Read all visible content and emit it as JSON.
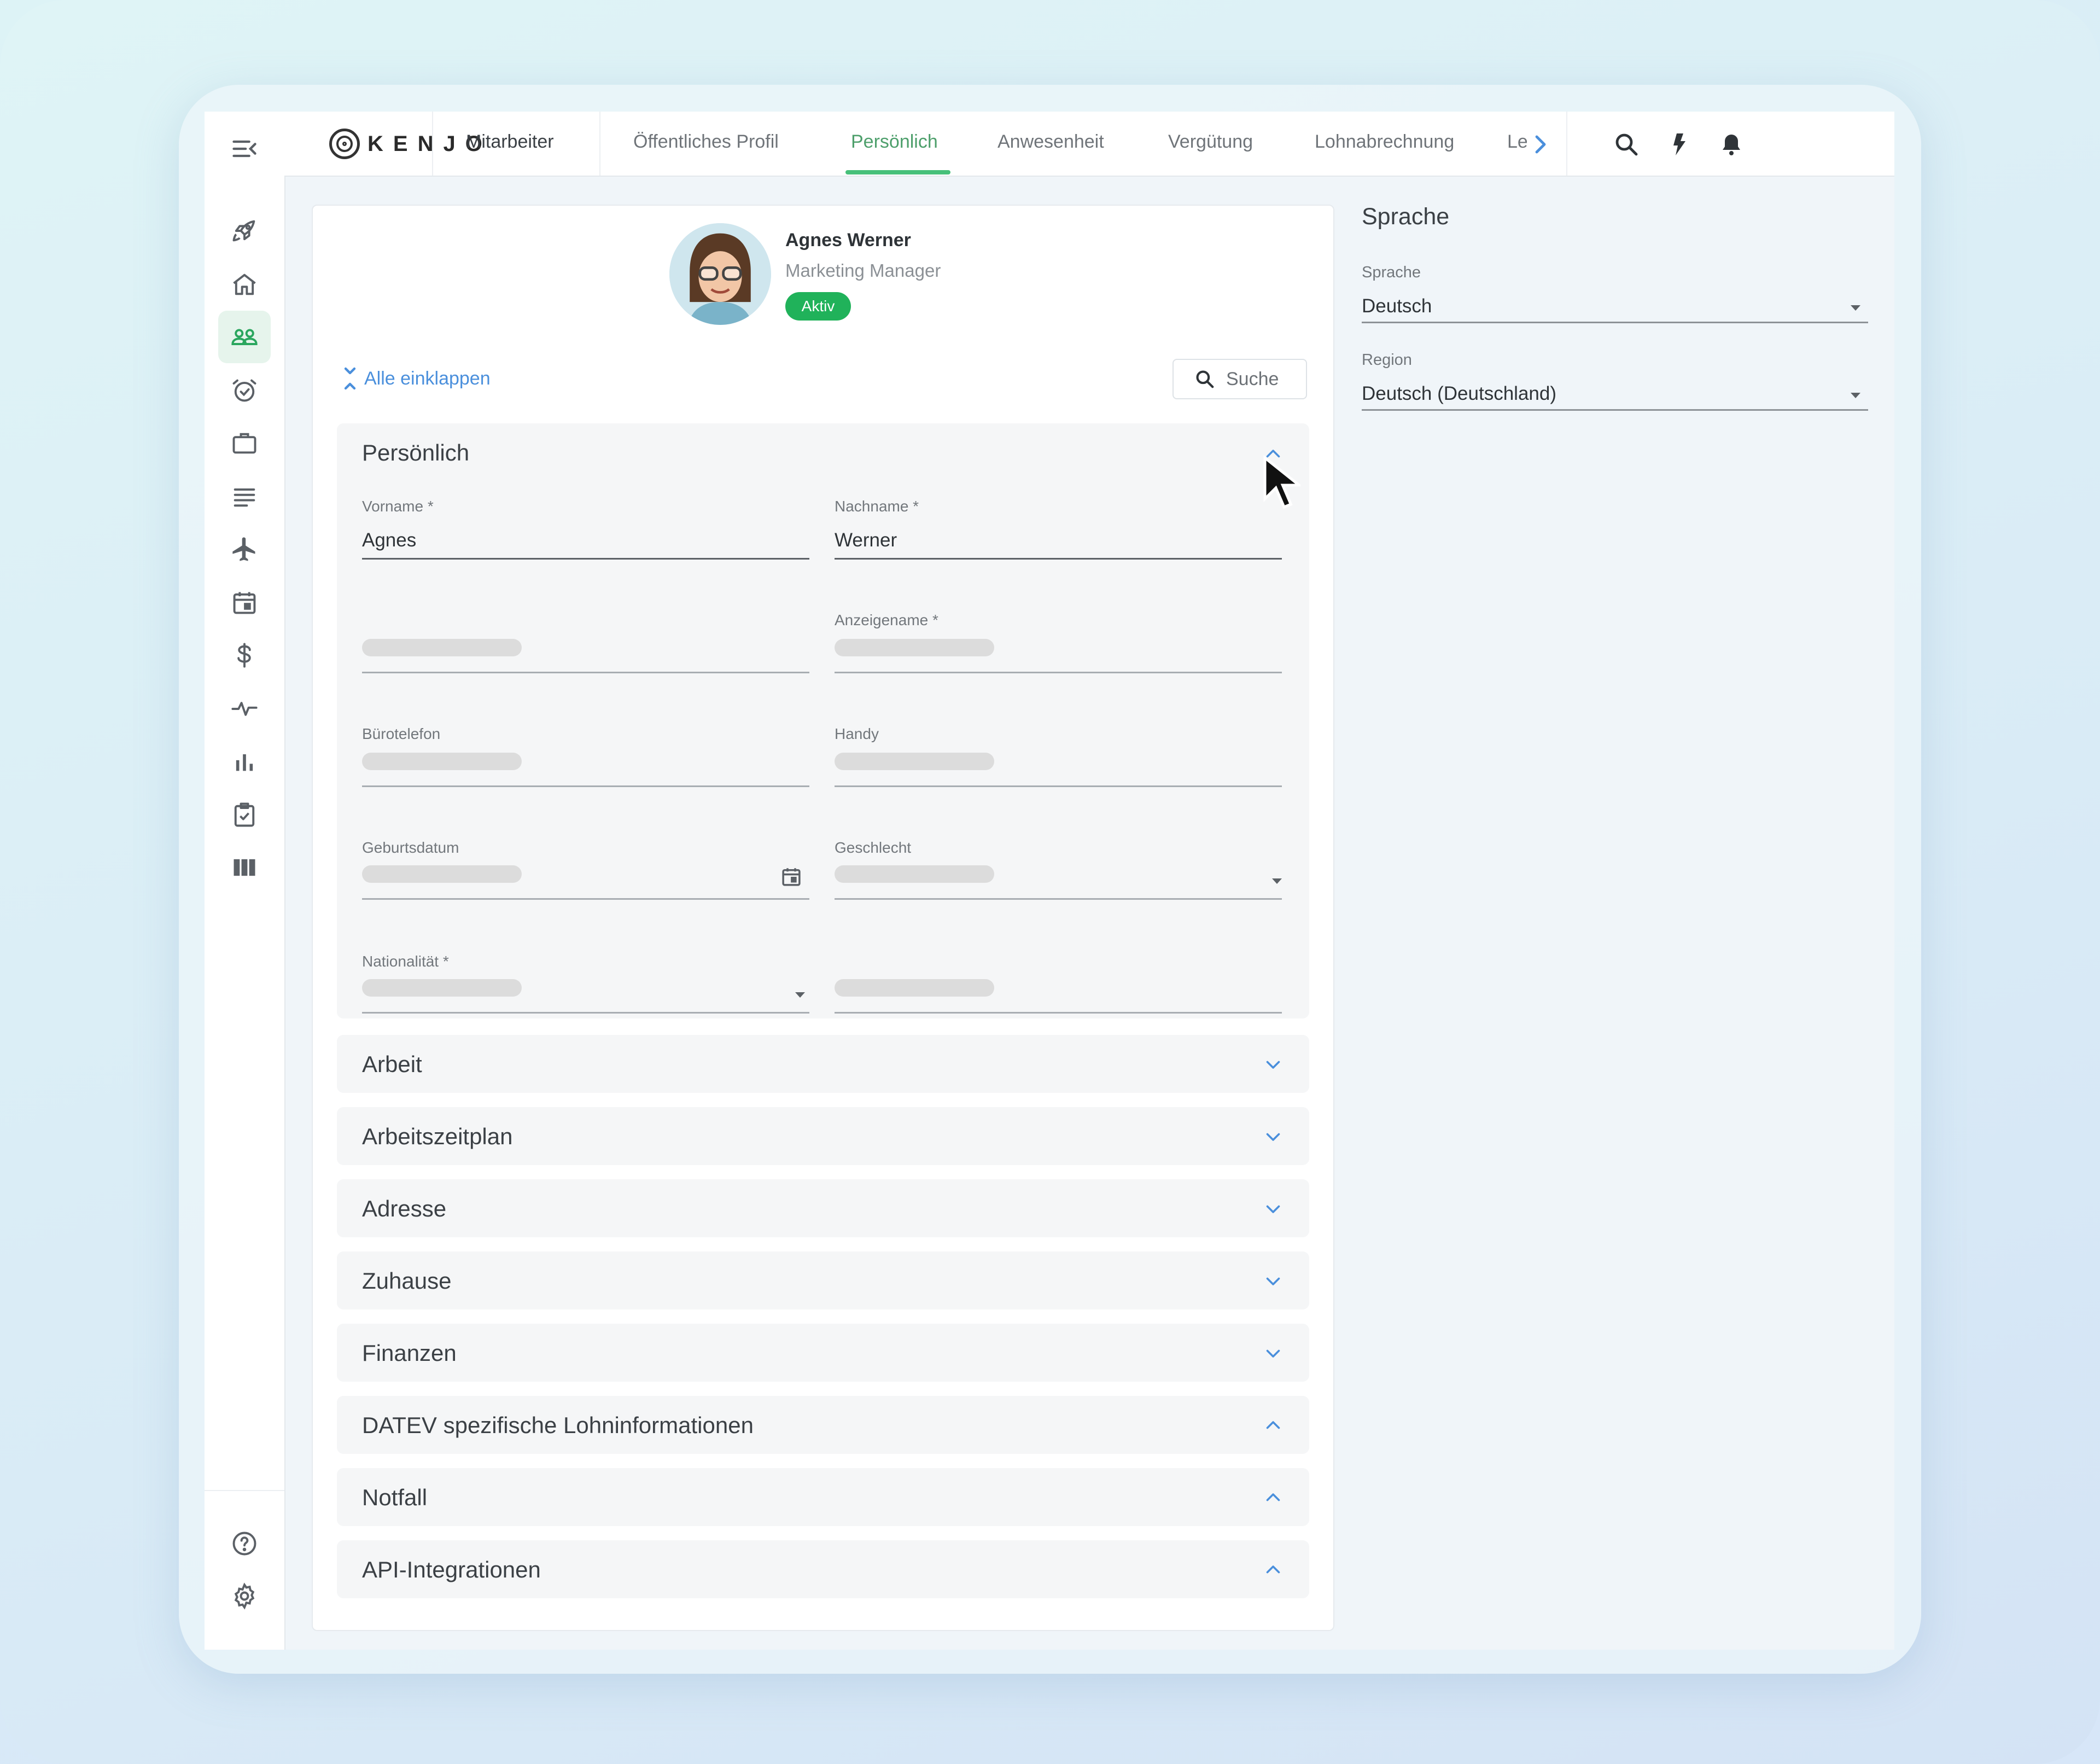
{
  "nav": {
    "logo_text": "KENJO",
    "tabs": [
      "Mitarbeiter",
      "Öffentliches Profil",
      "Persönlich",
      "Anwesenheit",
      "Vergütung",
      "Lohnabrechnung",
      "Le"
    ],
    "active_tab": "Persönlich"
  },
  "profile": {
    "name": "Agnes Werner",
    "role": "Marketing Manager",
    "status": "Aktiv"
  },
  "toolbar": {
    "collapse_all": "Alle einklappen",
    "search_label": "Suche"
  },
  "personal_section": {
    "title": "Persönlich",
    "fields": {
      "first_name_label": "Vorname *",
      "first_name_value": "Agnes",
      "last_name_label": "Nachname *",
      "last_name_value": "Werner",
      "display_name_label": "Anzeigename *",
      "office_phone_label": "Bürotelefon",
      "mobile_label": "Handy",
      "birthdate_label": "Geburtsdatum",
      "gender_label": "Geschlecht",
      "nationality_label": "Nationalität *"
    }
  },
  "sections": [
    {
      "title": "Arbeit",
      "state": "collapsed"
    },
    {
      "title": "Arbeitszeitplan",
      "state": "collapsed"
    },
    {
      "title": "Adresse",
      "state": "collapsed"
    },
    {
      "title": "Zuhause",
      "state": "collapsed"
    },
    {
      "title": "Finanzen",
      "state": "collapsed"
    },
    {
      "title": "DATEV spezifische Lohninformationen",
      "state": "expanded"
    },
    {
      "title": "Notfall",
      "state": "expanded"
    },
    {
      "title": "API-Integrationen",
      "state": "expanded"
    }
  ],
  "language_panel": {
    "title": "Sprache",
    "language_label": "Sprache",
    "language_value": "Deutsch",
    "region_label": "Region",
    "region_value": "Deutsch (Deutschland)"
  },
  "colors": {
    "accent_green": "#47c07a",
    "status_green": "#20b25a",
    "link_blue": "#4a8fdc"
  }
}
